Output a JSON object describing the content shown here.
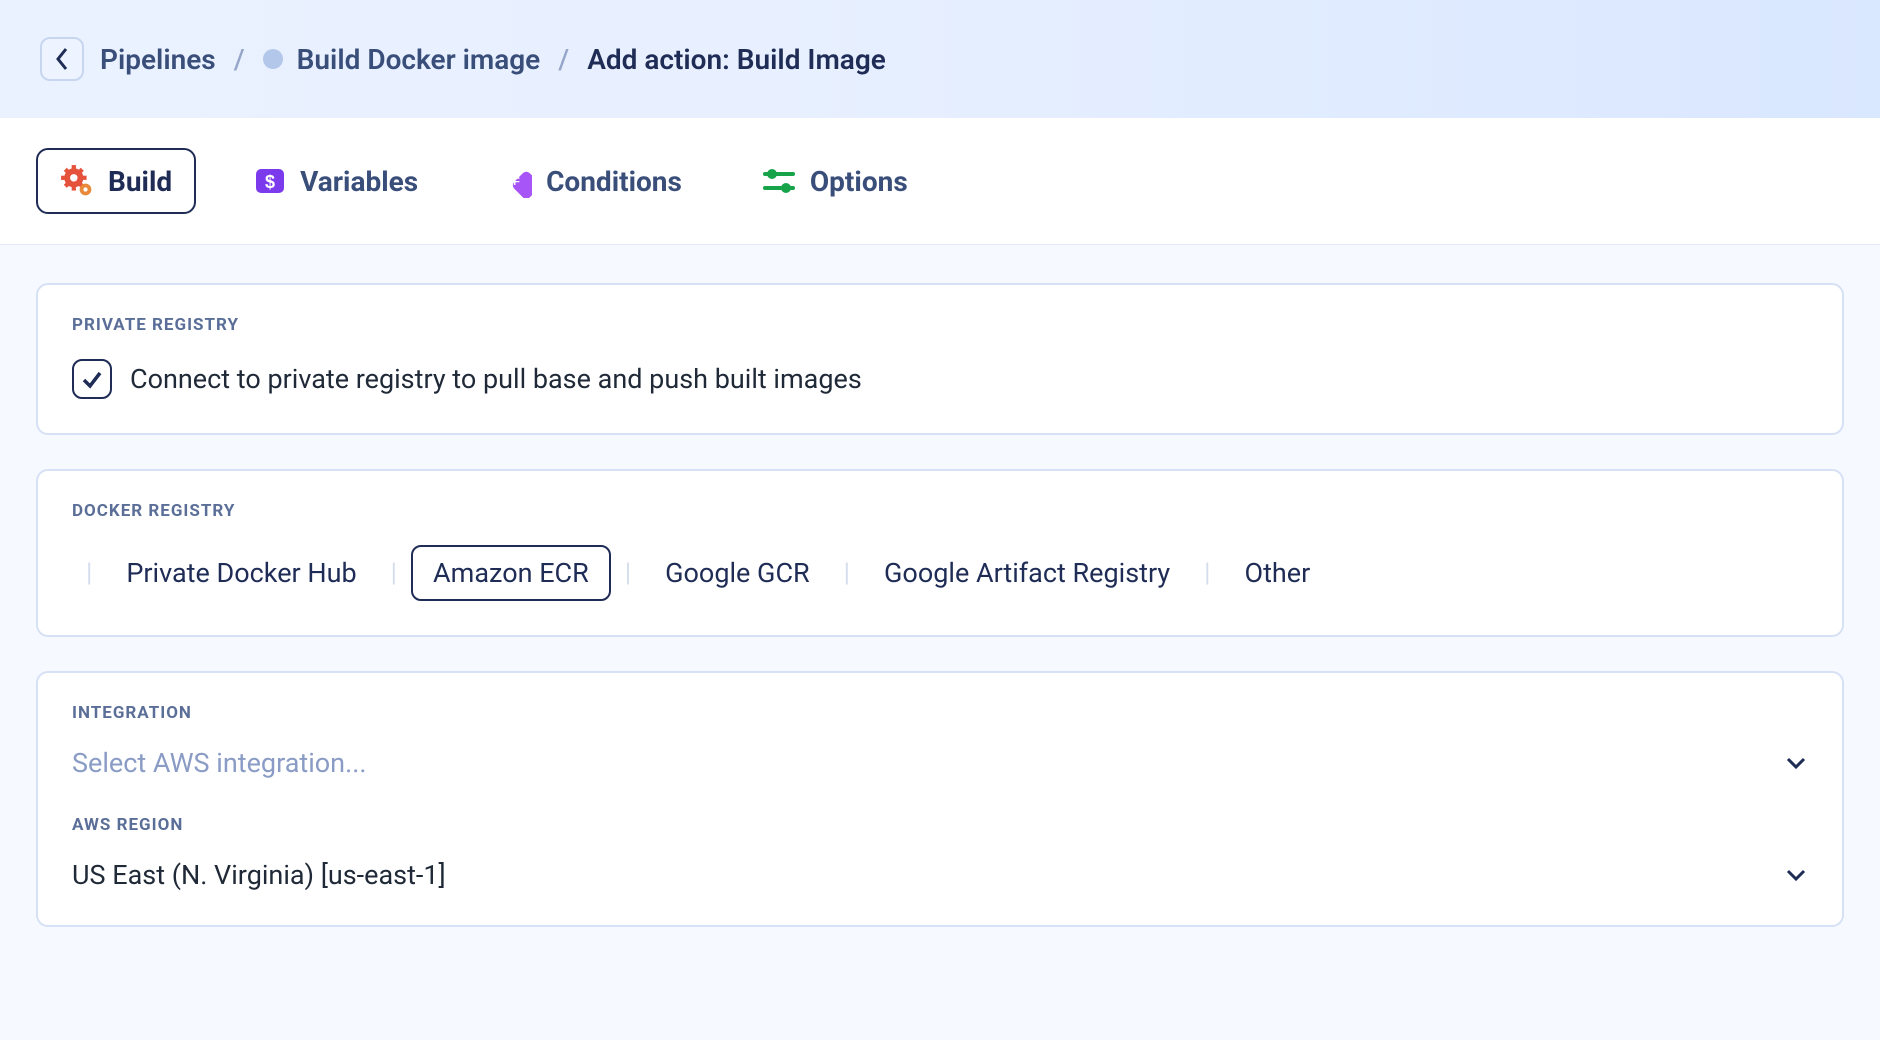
{
  "breadcrumb": {
    "items": [
      "Pipelines",
      "Build Docker image",
      "Add action: Build Image"
    ]
  },
  "tabs": [
    {
      "label": "Build"
    },
    {
      "label": "Variables"
    },
    {
      "label": "Conditions"
    },
    {
      "label": "Options"
    }
  ],
  "private_registry": {
    "title": "PRIVATE REGISTRY",
    "checkbox_label": "Connect to private registry to pull base and push built images"
  },
  "docker_registry": {
    "title": "DOCKER REGISTRY",
    "options": [
      "Private Docker Hub",
      "Amazon ECR",
      "Google GCR",
      "Google Artifact Registry",
      "Other"
    ]
  },
  "integration": {
    "title": "INTEGRATION",
    "placeholder": "Select AWS integration..."
  },
  "aws_region": {
    "title": "AWS REGION",
    "value": "US East (N. Virginia) [us-east-1]"
  }
}
